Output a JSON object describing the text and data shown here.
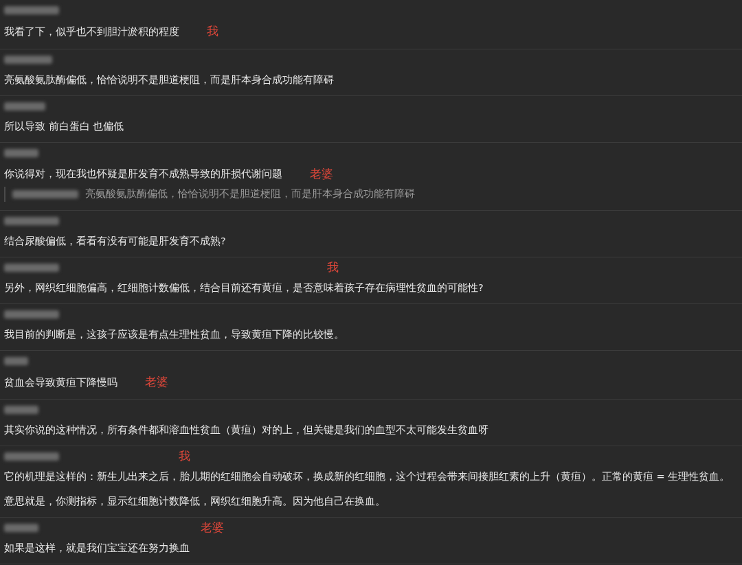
{
  "messages": [
    {
      "paragraphs": [
        "我看了下，似乎也不到胆汁淤积的程度"
      ],
      "annotation": {
        "text": "我",
        "kind": "inline"
      }
    },
    {
      "paragraphs": [
        "亮氨酸氨肽酶偏低，恰恰说明不是胆道梗阻，而是肝本身合成功能有障碍"
      ]
    },
    {
      "paragraphs": [
        "所以导致 前白蛋白 也偏低"
      ]
    },
    {
      "paragraphs": [
        "你说得对，现在我也怀疑是肝发育不成熟导致的肝损代谢问题"
      ],
      "annotation": {
        "text": "老婆",
        "kind": "inline"
      },
      "quote": "亮氨酸氨肽酶偏低，恰恰说明不是胆道梗阻，而是肝本身合成功能有障碍"
    },
    {
      "paragraphs": [
        "结合尿酸偏低，看看有没有可能是肝发育不成熟?"
      ]
    },
    {
      "paragraphs": [
        "另外，网织红细胞偏高，红细胞计数偏低，结合目前还有黄疸，是否意味着孩子存在病理性贫血的可能性?"
      ],
      "annotation": {
        "text": "我",
        "kind": "above"
      }
    },
    {
      "paragraphs": [
        "我目前的判断是，这孩子应该是有点生理性贫血，导致黄疸下降的比较慢。"
      ]
    },
    {
      "paragraphs": [
        "贫血会导致黄疸下降慢吗"
      ],
      "annotation": {
        "text": "老婆",
        "kind": "inline"
      }
    },
    {
      "paragraphs": [
        "其实你说的这种情况，所有条件都和溶血性贫血（黄疸）对的上，但关键是我们的血型不太可能发生贫血呀"
      ]
    },
    {
      "paragraphs": [
        "它的机理是这样的：新生儿出来之后，胎儿期的红细胞会自动破坏，换成新的红细胞，这个过程会带来间接胆红素的上升（黄疸）。正常的黄疸 = 生理性贫血。",
        "意思就是，你测指标，显示红细胞计数降低，网织红细胞升高。因为他自己在换血。"
      ],
      "annotation": {
        "text": "我",
        "kind": "above"
      }
    },
    {
      "paragraphs": [
        "如果是这样，就是我们宝宝还在努力换血"
      ],
      "annotation": {
        "text": "老婆",
        "kind": "above"
      }
    }
  ]
}
